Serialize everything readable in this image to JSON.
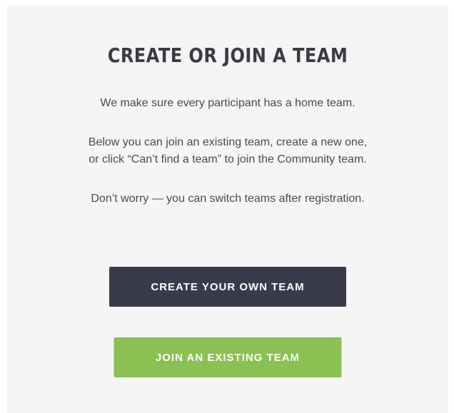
{
  "card": {
    "title": "CREATE OR JOIN A TEAM",
    "intro": "We make sure every participant has a home team.",
    "instructions_line1": "Below you can join an existing team, create a new one,",
    "instructions_line2": "or click “Can’t find a team” to join the Community team.",
    "reassurance": "Don’t worry — you can switch teams after registration."
  },
  "buttons": {
    "create_label": "CREATE YOUR OWN TEAM",
    "join_label": "JOIN AN EXISTING TEAM"
  },
  "colors": {
    "panel_bg": "#f5f5f5",
    "title": "#3b3b46",
    "body_text": "#4a4a50",
    "create_button": "#3a3b4a",
    "join_button": "#8bc052"
  }
}
